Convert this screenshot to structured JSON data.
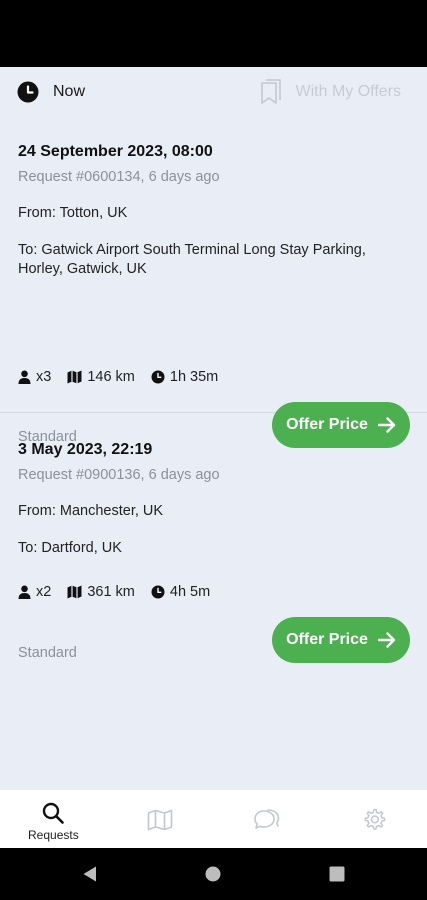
{
  "filters": {
    "now_label": "Now",
    "offers_label": "With My Offers"
  },
  "requests": [
    {
      "date": "24 September 2023, 08:00",
      "request_info": "Request #0600134, 6 days ago",
      "from": "From: Totton, UK",
      "to": "To: Gatwick Airport South Terminal Long Stay Parking, Horley, Gatwick, UK",
      "passengers": "x3",
      "distance": "146 km",
      "duration": "1h 35m",
      "category": "Standard",
      "action_label": "Offer Price"
    },
    {
      "date": "3 May 2023, 22:19",
      "request_info": "Request #0900136, 6 days ago",
      "from": "From: Manchester, UK",
      "to": "To: Dartford, UK",
      "passengers": "x2",
      "distance": "361 km",
      "duration": "4h 5m",
      "category": "Standard",
      "action_label": "Offer Price"
    }
  ],
  "bottom_nav": {
    "requests_label": "Requests"
  },
  "colors": {
    "accent": "#4caf50",
    "background": "#e9eef6",
    "muted_text": "#8d9098"
  }
}
